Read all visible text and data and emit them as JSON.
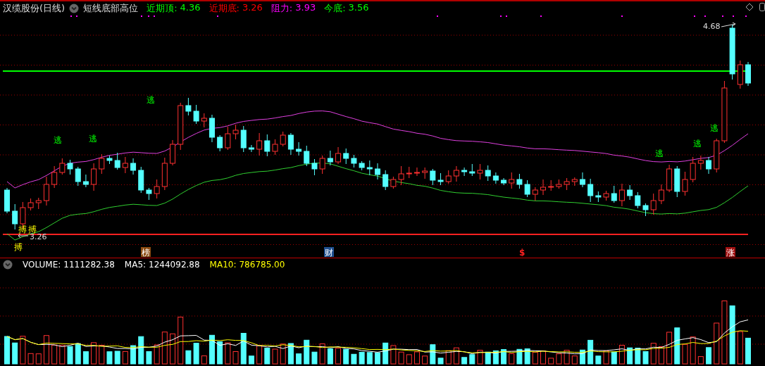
{
  "header": {
    "stock": "汉缆股份(日线)",
    "indicator": "短线底部高位",
    "readings": [
      {
        "label": "近期顶:",
        "value": "4.36",
        "color": "#00ff00"
      },
      {
        "label": "近期底:",
        "value": "3.26",
        "color": "#ff0000"
      },
      {
        "label": "阻力:",
        "value": "3.93",
        "color": "#ff00ff"
      },
      {
        "label": "今底:",
        "value": "3.56",
        "color": "#00ff00"
      }
    ]
  },
  "chart": {
    "high_label": "4.68",
    "low_label": "3.26",
    "signals": [
      {
        "label": "逃",
        "kind": "escape"
      },
      {
        "label": "逃",
        "kind": "escape"
      },
      {
        "label": "逃",
        "kind": "escape"
      },
      {
        "label": "逃",
        "kind": "escape"
      },
      {
        "label": "逃",
        "kind": "escape"
      },
      {
        "label": "逃",
        "kind": "escape"
      },
      {
        "label": "搏",
        "kind": "buy"
      },
      {
        "label": "搏",
        "kind": "buy"
      },
      {
        "label": "搏",
        "kind": "buy"
      }
    ],
    "markers": [
      {
        "label": "榜",
        "kind": "badge",
        "color": "#8b4a10"
      },
      {
        "label": "财",
        "kind": "badge",
        "color": "#1f4f8f"
      },
      {
        "label": "$",
        "kind": "text",
        "color": "#ff2020"
      },
      {
        "label": "涨",
        "kind": "badge",
        "color": "#a01010"
      }
    ]
  },
  "volume": {
    "readings": [
      {
        "label": "VOLUME:",
        "value": "1111282.38",
        "color": "#ffffff"
      },
      {
        "label": "MA5:",
        "value": "1244092.88",
        "color": "#ffffff"
      },
      {
        "label": "MA10:",
        "value": "786785.00",
        "color": "#ffff00"
      }
    ]
  }
}
